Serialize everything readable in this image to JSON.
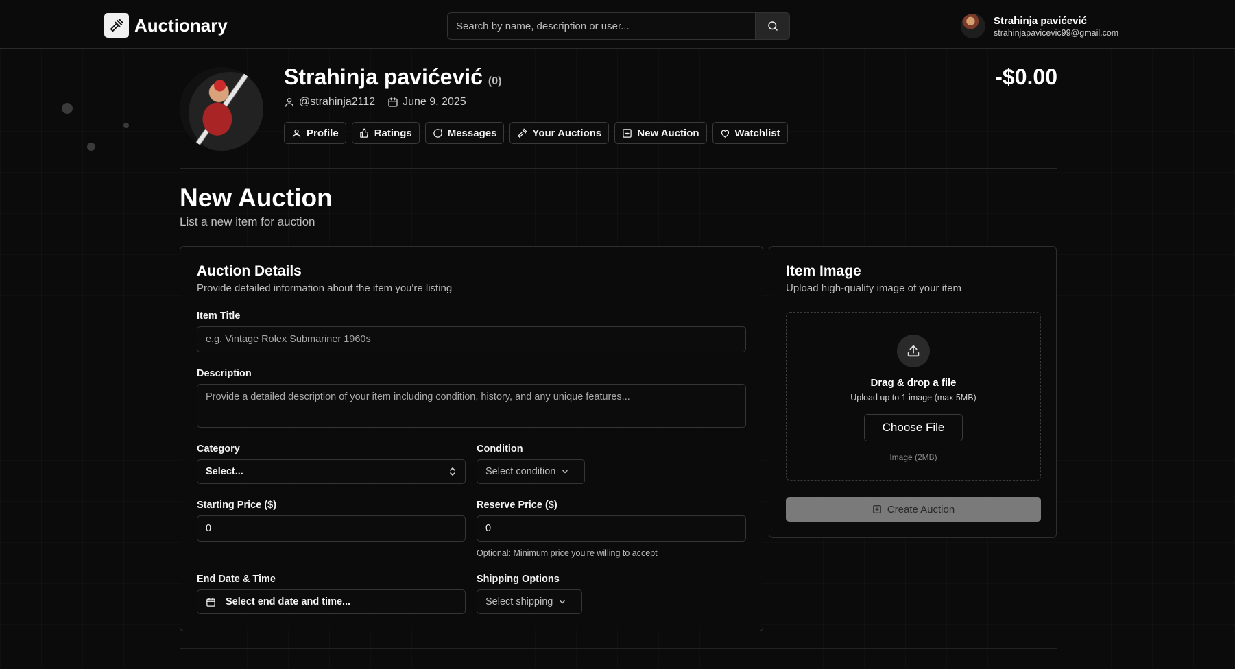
{
  "app": {
    "name": "Auctionary",
    "logo_icon": "gavel-icon"
  },
  "search": {
    "placeholder": "Search by name, description or user..."
  },
  "user": {
    "name": "Strahinja pavićević",
    "email": "strahinjapavicevic99@gmail.com"
  },
  "profile": {
    "name": "Strahinja pavićević",
    "rating_count": "(0)",
    "username": "@strahinja2112",
    "joined": "June 9, 2025",
    "balance": "-$0.00"
  },
  "nav": {
    "items": [
      {
        "label": "Profile",
        "icon": "user-icon"
      },
      {
        "label": "Ratings",
        "icon": "thumbs-up-icon"
      },
      {
        "label": "Messages",
        "icon": "message-icon"
      },
      {
        "label": "Your Auctions",
        "icon": "gavel-icon"
      },
      {
        "label": "New Auction",
        "icon": "plus-square-icon"
      },
      {
        "label": "Watchlist",
        "icon": "heart-icon"
      }
    ]
  },
  "page": {
    "title": "New Auction",
    "subtitle": "List a new item for auction"
  },
  "details": {
    "title": "Auction Details",
    "subtitle": "Provide detailed information about the item you're listing",
    "item_title_label": "Item Title",
    "item_title_placeholder": "e.g. Vintage Rolex Submariner 1960s",
    "description_label": "Description",
    "description_placeholder": "Provide a detailed description of your item including condition, history, and any unique features...",
    "category_label": "Category",
    "category_value": "Select...",
    "condition_label": "Condition",
    "condition_value": "Select condition",
    "starting_price_label": "Starting Price ($)",
    "starting_price_value": "0",
    "reserve_price_label": "Reserve Price ($)",
    "reserve_price_value": "0",
    "reserve_hint": "Optional: Minimum price you're willing to accept",
    "end_date_label": "End Date & Time",
    "end_date_value": "Select end date and time...",
    "shipping_label": "Shipping Options",
    "shipping_value": "Select shipping"
  },
  "image": {
    "title": "Item Image",
    "subtitle": "Upload high-quality image of your item",
    "drop_title": "Drag & drop a file",
    "drop_sub": "Upload up to 1 image (max 5MB)",
    "choose_label": "Choose File",
    "note": "Image (2MB)",
    "create_label": "Create Auction"
  }
}
